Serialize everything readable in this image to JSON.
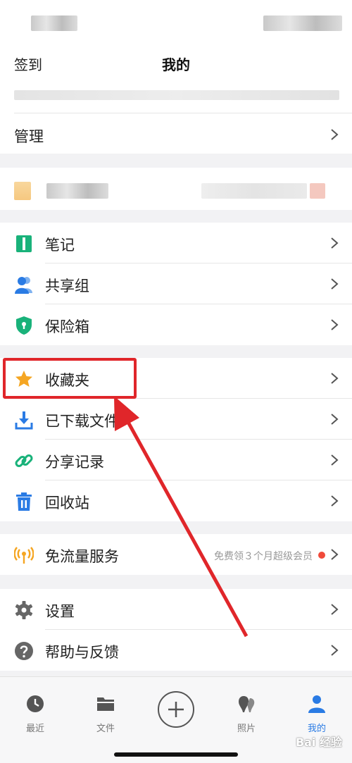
{
  "nav": {
    "left_label": "签到",
    "title": "我的"
  },
  "manage": {
    "label": "管理"
  },
  "group_tools": [
    {
      "label": "笔记",
      "icon": "note-icon"
    },
    {
      "label": "共享组",
      "icon": "share-group-icon"
    },
    {
      "label": "保险箱",
      "icon": "safe-box-icon"
    }
  ],
  "group_files": [
    {
      "label": "收藏夹",
      "icon": "star-icon"
    },
    {
      "label": "已下载文件",
      "icon": "download-icon"
    },
    {
      "label": "分享记录",
      "icon": "link-icon"
    },
    {
      "label": "回收站",
      "icon": "trash-icon"
    }
  ],
  "free_traffic": {
    "label": "免流量服务",
    "promo": "免费领３个月超级会员",
    "icon": "signal-icon"
  },
  "group_settings": [
    {
      "label": "设置",
      "icon": "gear-icon"
    },
    {
      "label": "帮助与反馈",
      "icon": "help-icon"
    }
  ],
  "tabs": [
    {
      "label": "最近",
      "icon": "clock-icon"
    },
    {
      "label": "文件",
      "icon": "folder-icon"
    },
    {
      "label": "照片",
      "icon": "photos-icon"
    },
    {
      "label": "我的",
      "icon": "person-icon"
    }
  ],
  "colors": {
    "accent": "#2a7be4",
    "note_green": "#19b27a",
    "star_orange": "#f5a623",
    "highlight_red": "#e0262a",
    "promo_dot": "#f04a3a"
  },
  "watermark": "Bai 经验"
}
